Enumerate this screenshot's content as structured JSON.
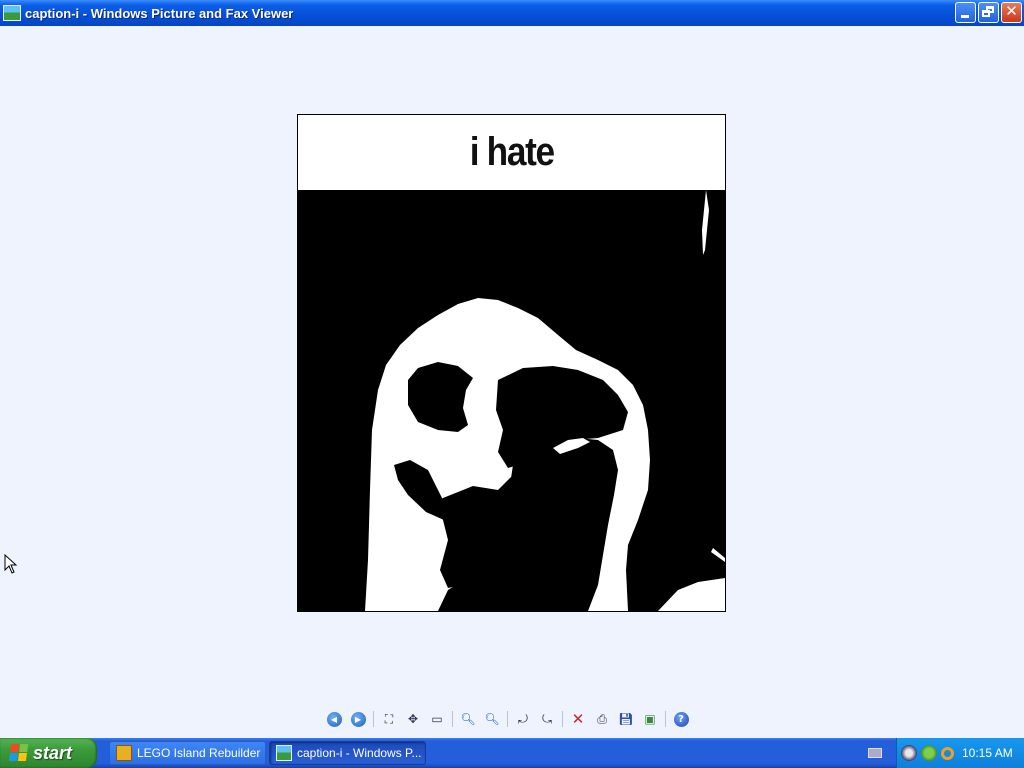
{
  "window": {
    "title": "caption-i - Windows Picture and Fax Viewer",
    "icon": "picture-viewer-icon"
  },
  "image": {
    "caption_text": "i hate",
    "background_color": "#eef3fd"
  },
  "toolbar": {
    "buttons": [
      {
        "name": "previous-image",
        "icon": "previous-icon"
      },
      {
        "name": "next-image",
        "icon": "next-icon"
      },
      {
        "name": "best-fit",
        "icon": "best-fit-icon"
      },
      {
        "name": "actual-size",
        "icon": "actual-size-icon"
      },
      {
        "name": "slideshow",
        "icon": "slideshow-icon"
      },
      {
        "name": "zoom-in",
        "icon": "zoom-in-icon"
      },
      {
        "name": "zoom-out",
        "icon": "zoom-out-icon"
      },
      {
        "name": "rotate-clockwise",
        "icon": "rotate-clockwise-icon"
      },
      {
        "name": "rotate-counterclockwise",
        "icon": "rotate-counterclockwise-icon"
      },
      {
        "name": "delete",
        "icon": "delete-icon"
      },
      {
        "name": "print",
        "icon": "print-icon"
      },
      {
        "name": "save",
        "icon": "save-icon"
      },
      {
        "name": "edit",
        "icon": "edit-icon"
      },
      {
        "name": "help",
        "icon": "help-icon"
      }
    ]
  },
  "taskbar": {
    "start_label": "start",
    "items": [
      {
        "label": "LEGO Island Rebuilder",
        "icon": "lego-island-icon",
        "active": false
      },
      {
        "label": "caption-i - Windows P...",
        "icon": "picture-viewer-icon",
        "active": true
      }
    ],
    "tray_icons": [
      "network-icon",
      "shield-icon",
      "search-icon"
    ],
    "clock": "10:15 AM"
  },
  "colors": {
    "titlebar": "#0650d8",
    "taskbar": "#245edb",
    "start_button": "#3b9b3b",
    "tray": "#0f7fda",
    "delete": "#c0282a"
  }
}
